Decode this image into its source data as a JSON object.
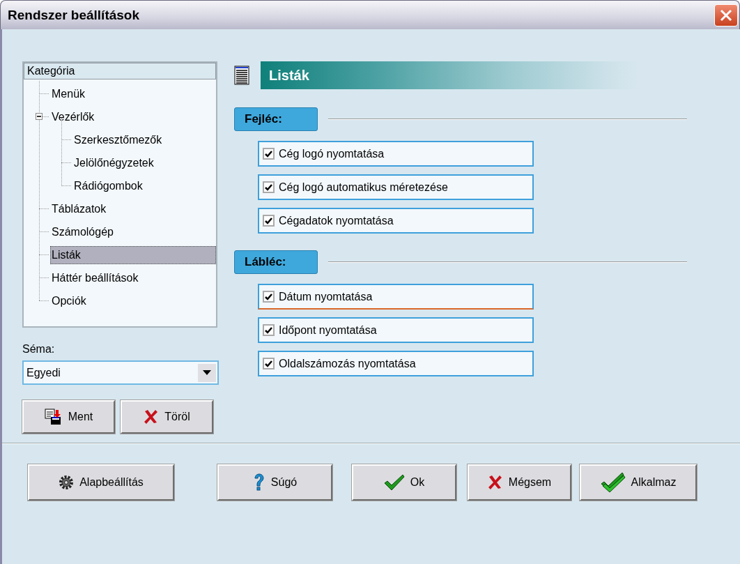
{
  "window": {
    "title": "Rendszer beállítások"
  },
  "category_tree": {
    "header": "Kategória",
    "items": [
      {
        "label": "Menük",
        "selected": false
      },
      {
        "label": "Vezérlők",
        "selected": false,
        "expanded": true,
        "children": [
          {
            "label": "Szerkesztőmezők",
            "selected": false
          },
          {
            "label": "Jelölőnégyzetek",
            "selected": false
          },
          {
            "label": "Rádiógombok",
            "selected": false
          }
        ]
      },
      {
        "label": "Táblázatok",
        "selected": false
      },
      {
        "label": "Számológép",
        "selected": false
      },
      {
        "label": "Listák",
        "selected": true
      },
      {
        "label": "Háttér beállítások",
        "selected": false
      },
      {
        "label": "Opciók",
        "selected": false
      }
    ]
  },
  "schema": {
    "label": "Séma:",
    "value": "Egyedi"
  },
  "schema_buttons": [
    {
      "kind": "save",
      "label": "Ment"
    },
    {
      "kind": "delete",
      "label": "Töröl"
    }
  ],
  "section": {
    "title": "Listák"
  },
  "groups": [
    {
      "title": "Fejléc:",
      "options": [
        {
          "label": "Cég logó nyomtatása",
          "checked": true,
          "focused": false
        },
        {
          "label": "Cég logó automatikus méretezése",
          "checked": true,
          "focused": false
        },
        {
          "label": "Cégadatok nyomtatása",
          "checked": true,
          "focused": false
        }
      ]
    },
    {
      "title": "Lábléc:",
      "options": [
        {
          "label": "Dátum nyomtatása",
          "checked": true,
          "focused": true
        },
        {
          "label": "Időpont nyomtatása",
          "checked": true,
          "focused": false
        },
        {
          "label": "Oldalszámozás nyomtatása",
          "checked": true,
          "focused": false
        }
      ]
    }
  ],
  "footer_buttons": [
    {
      "kind": "defaults",
      "label": "Alapbeállítás"
    },
    {
      "kind": "help",
      "label": "Súgó"
    },
    {
      "kind": "ok",
      "label": "Ok"
    },
    {
      "kind": "cancel",
      "label": "Mégsem"
    },
    {
      "kind": "apply",
      "label": "Alkalmaz"
    }
  ]
}
